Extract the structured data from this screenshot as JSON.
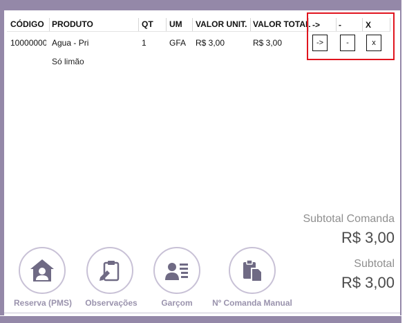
{
  "table": {
    "headers": [
      "CÓDIGO",
      "PRODUTO",
      "QT",
      "UM",
      "VALOR UNIT.",
      "VALOR TOTAL"
    ],
    "rows": [
      {
        "codigo": "10000000",
        "produto": "Agua - Pri",
        "qt": "1",
        "um": "GFA",
        "valor_unit": "R$ 3,00",
        "valor_total": "R$ 3,00",
        "observacao": "Só limão"
      }
    ],
    "action_headers": [
      "->",
      "-",
      "X"
    ],
    "action_buttons": [
      "->",
      "-",
      "x"
    ]
  },
  "summary": {
    "subtotal_comanda_label": "Subtotal Comanda",
    "subtotal_comanda_value": "R$ 3,00",
    "subtotal_label": "Subtotal",
    "subtotal_value": "R$ 3,00"
  },
  "actions": [
    {
      "label": "Reserva (PMS)",
      "icon": "house-person-icon"
    },
    {
      "label": "Observações",
      "icon": "clipboard-pen-icon"
    },
    {
      "label": "Garçom",
      "icon": "person-list-icon"
    },
    {
      "label": "Nº Comanda Manual",
      "icon": "clipboard-copy-icon"
    }
  ],
  "colors": {
    "frame": "#9488a8",
    "icon": "#6f6a84",
    "highlight": "#e0141e"
  }
}
